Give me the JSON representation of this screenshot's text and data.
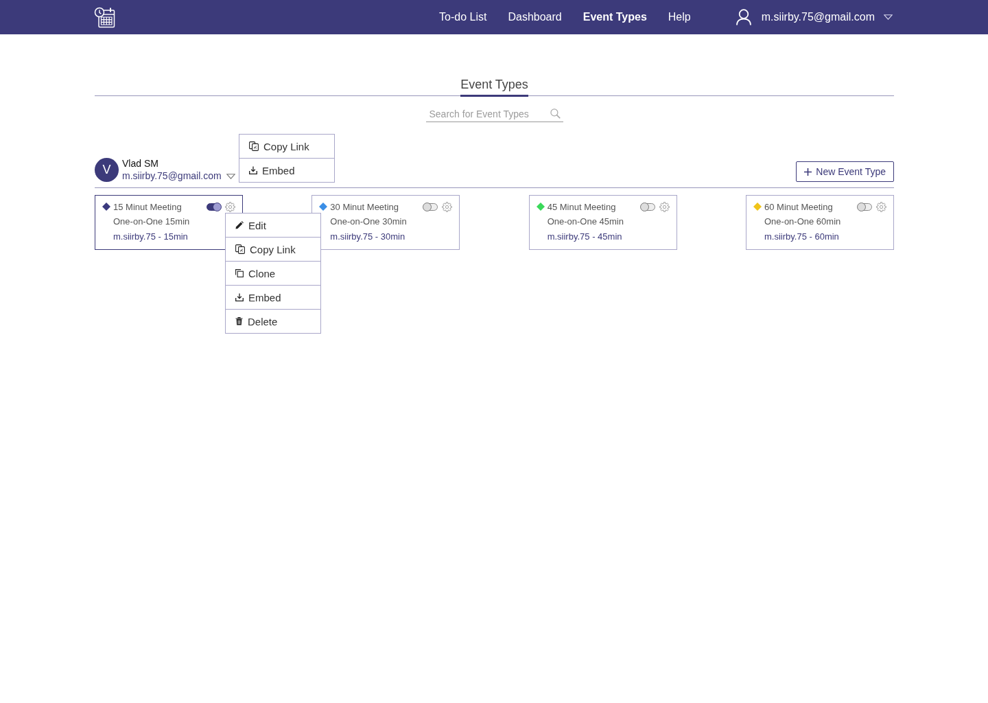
{
  "header": {
    "nav": [
      {
        "label": "To-do List",
        "selected": false
      },
      {
        "label": "Dashboard",
        "selected": false
      },
      {
        "label": "Event Types",
        "selected": true
      },
      {
        "label": "Help",
        "selected": false
      }
    ],
    "user_email": "m.siirby.75@gmail.com"
  },
  "page_tabs": [
    {
      "label": "Event Types",
      "selected": true
    }
  ],
  "search": {
    "placeholder": "Search for Event Types"
  },
  "profile": {
    "initial": "V",
    "name": "Vlad SM",
    "email": "m.siirby.75@gmail.com",
    "menu": [
      {
        "kind": "copy-link",
        "label": "Copy Link"
      },
      {
        "kind": "embed",
        "label": "Embed"
      }
    ]
  },
  "new_button": {
    "label": "New Event Type"
  },
  "event_types": [
    {
      "title": "15 Minut Meeting",
      "color": "#3b3a7e",
      "on": true,
      "selected": true,
      "subtitle": "One-on-One 15min",
      "link": "m.siirby.75 - 15min"
    },
    {
      "title": "30 Minut Meeting",
      "color": "#3a8ee6",
      "on": false,
      "selected": false,
      "subtitle": "One-on-One 30min",
      "link": "m.siirby.75 - 30min"
    },
    {
      "title": "45 Minut Meeting",
      "color": "#3ad95a",
      "on": false,
      "selected": false,
      "subtitle": "One-on-One 45min",
      "link": "m.siirby.75 - 45min"
    },
    {
      "title": "60 Minut Meeting",
      "color": "#f0c419",
      "on": false,
      "selected": false,
      "subtitle": "One-on-One 60min",
      "link": "m.siirby.75 - 60min"
    }
  ],
  "card_menu": [
    {
      "kind": "edit",
      "label": "Edit"
    },
    {
      "kind": "copy-link",
      "label": "Copy Link"
    },
    {
      "kind": "clone",
      "label": "Clone"
    },
    {
      "kind": "embed",
      "label": "Embed"
    },
    {
      "kind": "delete",
      "label": "Delete"
    }
  ]
}
